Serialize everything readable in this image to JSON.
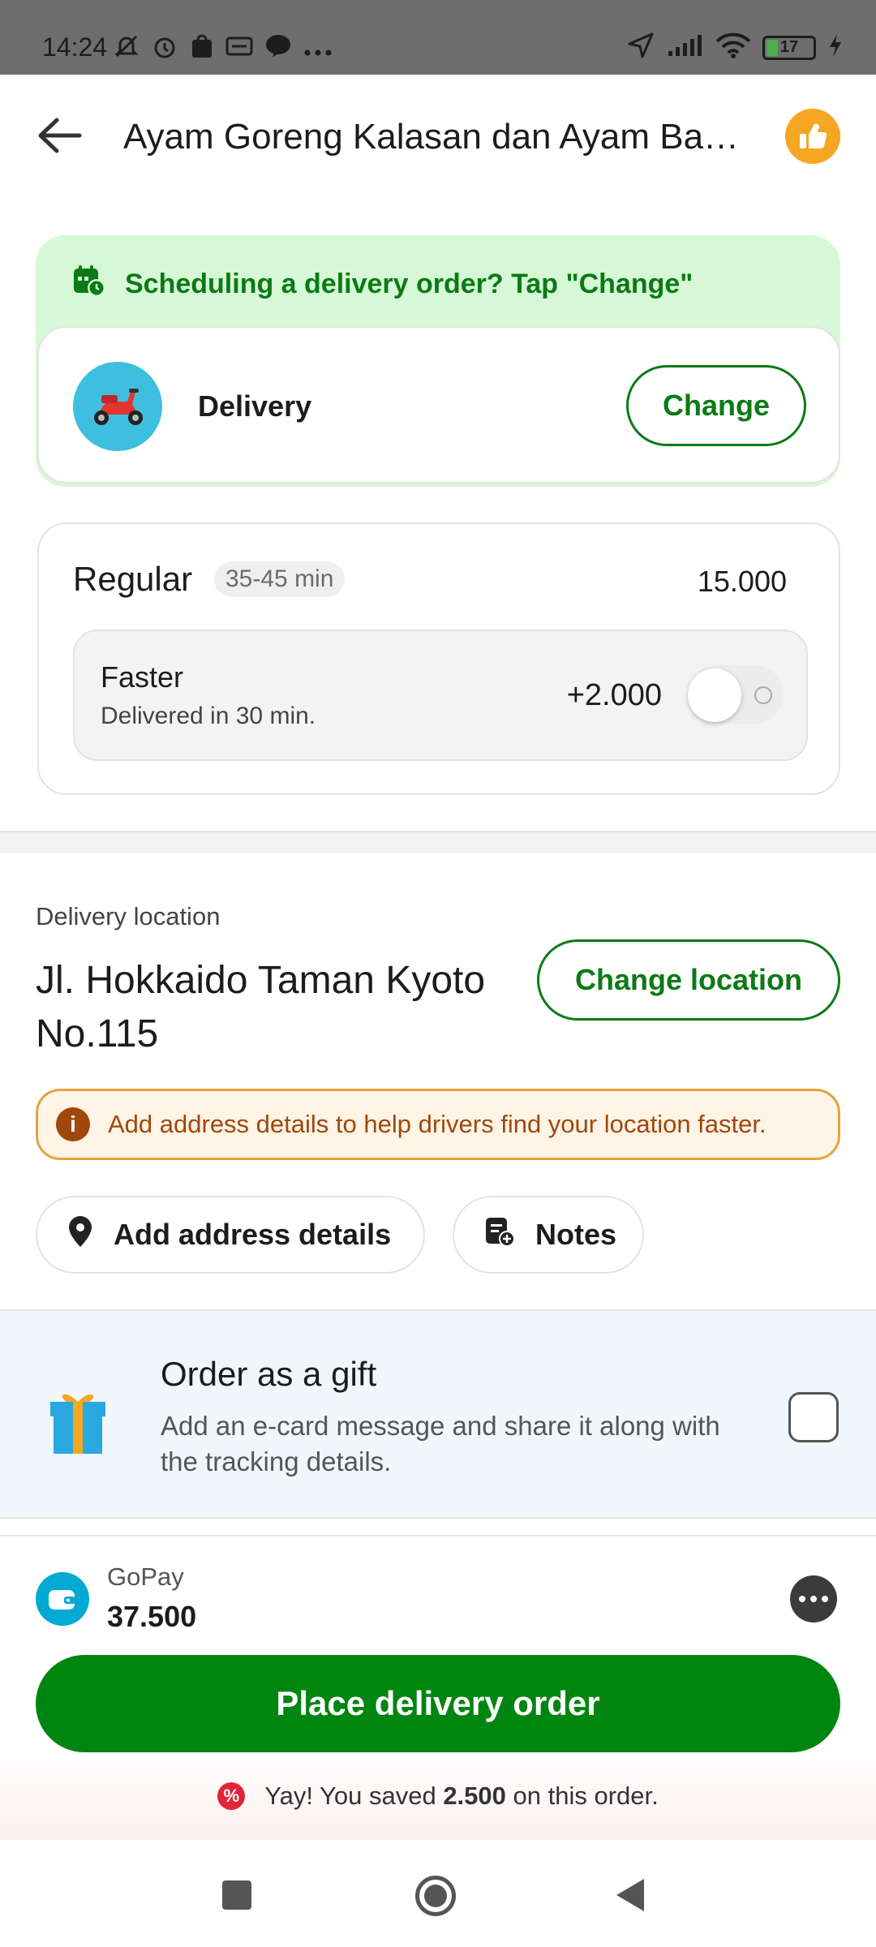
{
  "status_bar": {
    "time": "14:24",
    "battery": "17",
    "icons": [
      "mute-icon",
      "alarm-icon",
      "shopping-icon",
      "card-icon",
      "line-icon",
      "more-icon",
      "location-icon",
      "signal-icon",
      "wifi-icon",
      "battery-icon",
      "charging-icon"
    ]
  },
  "header": {
    "title": "Ayam Goreng Kalasan dan Ayam Baka...",
    "back_icon": "arrow-left-icon",
    "like_icon": "thumbs-up-icon"
  },
  "schedule": {
    "banner": "Scheduling a delivery order? Tap \"Change\"",
    "mode_label": "Delivery",
    "change_label": "Change"
  },
  "speed": {
    "title": "Regular",
    "time_range": "35-45 min",
    "price": "15.000",
    "faster_title": "Faster",
    "faster_sub": "Delivered in 30 min.",
    "faster_price": "+2.000",
    "faster_enabled": false
  },
  "location": {
    "label": "Delivery location",
    "address": "Jl. Hokkaido Taman Kyoto No.115",
    "change_label": "Change location",
    "warning": "Add address details to help drivers find your location faster.",
    "add_details_label": "Add address details",
    "notes_label": "Notes"
  },
  "gift": {
    "title": "Order as a gift",
    "description": "Add an e-card message and share it along with the tracking details.",
    "checked": false
  },
  "payment": {
    "method": "GoPay",
    "amount": "37.500",
    "place_order_label": "Place delivery order",
    "saved_prefix": "Yay! You saved",
    "saved_amount": "2.500",
    "saved_suffix": "on this order."
  },
  "colors": {
    "brand_green": "#008510",
    "text_green": "#0b7a16",
    "schedule_bg": "#d6f8d6",
    "warning_border": "#e7a33e",
    "warning_text": "#a0470c"
  }
}
